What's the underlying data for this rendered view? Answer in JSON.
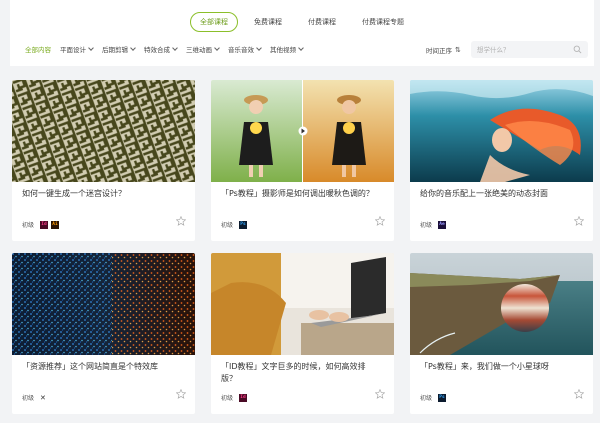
{
  "type_tabs": [
    {
      "label": "全部课程",
      "active": true
    },
    {
      "label": "免费课程",
      "active": false
    },
    {
      "label": "付费课程",
      "active": false
    },
    {
      "label": "付费课程专题",
      "active": false
    }
  ],
  "categories": [
    {
      "label": "全部内容",
      "active": true,
      "dropdown": false
    },
    {
      "label": "平面设计",
      "active": false,
      "dropdown": true
    },
    {
      "label": "后期剪辑",
      "active": false,
      "dropdown": true
    },
    {
      "label": "特效合成",
      "active": false,
      "dropdown": true
    },
    {
      "label": "三维动画",
      "active": false,
      "dropdown": true
    },
    {
      "label": "音乐音效",
      "active": false,
      "dropdown": true
    },
    {
      "label": "其他视频",
      "active": false,
      "dropdown": true
    }
  ],
  "sort": {
    "label": "时间正序",
    "icon": "sort-arrows-icon"
  },
  "search": {
    "placeholder": "想学什么？",
    "icon": "search-icon"
  },
  "colors": {
    "accent": "#7aab1f",
    "tab_border": "#8bbf2a"
  },
  "cards": [
    {
      "title": "如何一键生成一个迷宫设计？",
      "level": "初级",
      "tools": [
        "Id",
        "Ai"
      ],
      "thumb": "maze"
    },
    {
      "title": "「Ps教程」摄影师是如何调出暖秋色调的？",
      "level": "初级",
      "tools": [
        "Ps"
      ],
      "thumb": "girl-autumn"
    },
    {
      "title": "给你的音乐配上一张绝美的动态封面",
      "level": "初级",
      "tools": [
        "Ae"
      ],
      "thumb": "underwater-girl"
    },
    {
      "title": "「资源推荐」这个网站简直是个特效库",
      "level": "初级",
      "tools": [
        "x"
      ],
      "thumb": "particles"
    },
    {
      "title": "「ID教程」文字巨多的时候，如何高效排版？",
      "level": "初级",
      "tools": [
        "Id"
      ],
      "thumb": "laptop"
    },
    {
      "title": "「Ps教程」来，我们做一个小星球呀",
      "level": "初级",
      "tools": [
        "Ps"
      ],
      "thumb": "cliff-planet"
    }
  ]
}
